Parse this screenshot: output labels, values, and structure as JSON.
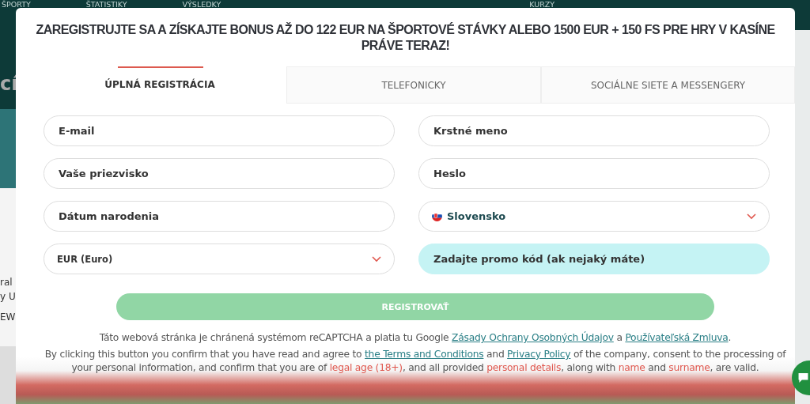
{
  "background_page": {
    "nav_items": [
      "ŠPORTY",
      "ŠTATISTIKY",
      "VÝSLEDKY",
      "KURZY"
    ],
    "side_texts": [
      "cí",
      "ral",
      "y U",
      "EW"
    ]
  },
  "modal": {
    "title": "ZAREGISTRUJTE SA A ZÍSKAJTE BONUS AŽ DO 122 EUR NA ŠPORTOVÉ STÁVKY ALEBO 1500 EUR + 150 FS PRE HRY V KASÍNE PRÁVE TERAZ!",
    "tabs": [
      {
        "label": "ÚPLNÁ REGISTRÁCIA",
        "selected": true
      },
      {
        "label": "TELEFONICKY",
        "selected": false
      },
      {
        "label": "SOCIÁLNE SIETE A MESSENGERY",
        "selected": false
      }
    ],
    "fields": [
      {
        "kind": "input",
        "placeholder": "E-mail"
      },
      {
        "kind": "input",
        "placeholder": "Krstné meno"
      },
      {
        "kind": "input",
        "placeholder": "Vaše priezvisko"
      },
      {
        "kind": "input",
        "placeholder": "Heslo"
      },
      {
        "kind": "input",
        "placeholder": "Dátum narodenia"
      },
      {
        "kind": "country",
        "value": "Slovensko"
      },
      {
        "kind": "select",
        "value": "EUR (Euro)"
      },
      {
        "kind": "promo",
        "placeholder": "Zadajte promo kód (ak nejaký máte)"
      }
    ],
    "submit_button": {
      "label": "REGISTROVAŤ",
      "disabled": true
    },
    "notices": [
      [
        {
          "kind": "plain",
          "text": "Táto webová stránka je chránená systémom reCAPTCHA a platia tu Google "
        },
        {
          "kind": "link",
          "text": "Zásady Ochrany Osobných Údajov"
        },
        {
          "kind": "plain",
          "text": " a "
        },
        {
          "kind": "link",
          "text": "Používateľská Zmluva"
        },
        {
          "kind": "plain",
          "text": "."
        }
      ],
      [
        {
          "kind": "plain",
          "text": "By clicking this button you confirm that you have read and agree to "
        },
        {
          "kind": "link",
          "text": "the Terms and Conditions"
        },
        {
          "kind": "plain",
          "text": " and "
        },
        {
          "kind": "link",
          "text": "Privacy Policy"
        },
        {
          "kind": "plain",
          "text": " of the company, consent to the processing of your personal information, and confirm that you are of "
        },
        {
          "kind": "highlight",
          "text": "legal age (18+)"
        },
        {
          "kind": "plain",
          "text": ", and all provided "
        },
        {
          "kind": "highlight",
          "text": "personal details"
        },
        {
          "kind": "plain",
          "text": ", along with "
        },
        {
          "kind": "highlight",
          "text": "name"
        },
        {
          "kind": "plain",
          "text": " and "
        },
        {
          "kind": "highlight",
          "text": "surname"
        },
        {
          "kind": "plain",
          "text": ", are valid."
        }
      ]
    ]
  }
}
